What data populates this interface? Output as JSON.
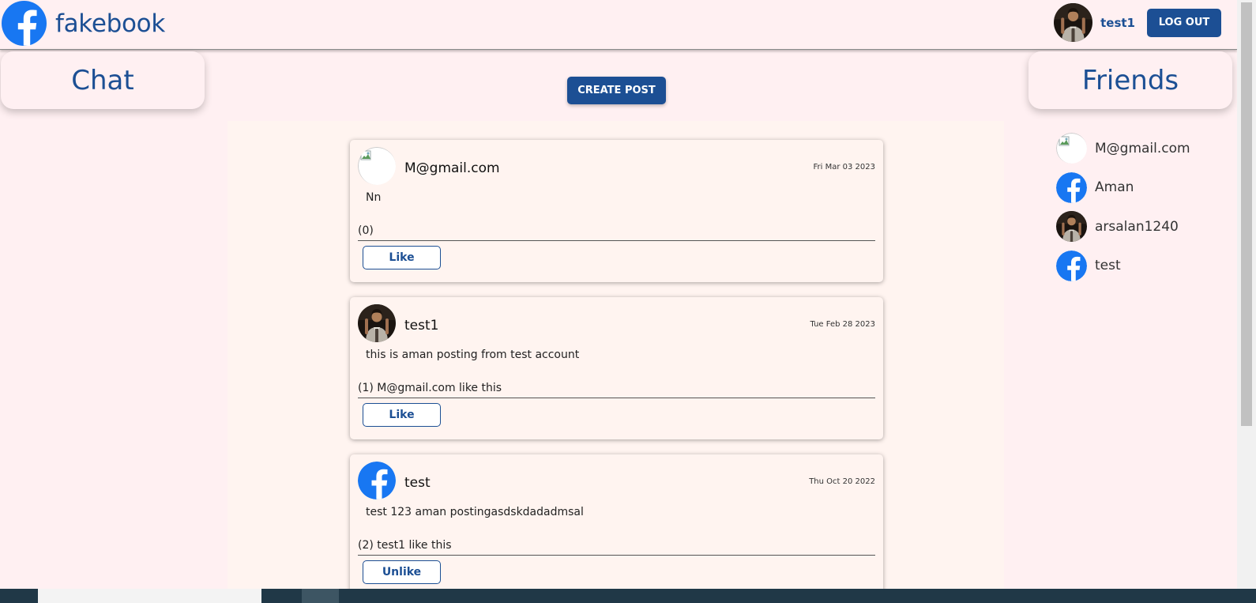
{
  "header": {
    "brand": "fakebook",
    "username": "test1",
    "logout_label": "LOG OUT"
  },
  "left_panel": {
    "title": "Chat"
  },
  "right_panel": {
    "title": "Friends"
  },
  "create_post_label": "CREATE POST",
  "posts": [
    {
      "author": "M@gmail.com",
      "date": "Fri Mar 03 2023",
      "body": "Nn",
      "likes": "(0)",
      "like_label": "Like",
      "avatar": "broken-image"
    },
    {
      "author": "test1",
      "date": "Tue Feb 28 2023",
      "body": "this is aman posting from test account",
      "likes": "(1) M@gmail.com like this",
      "like_label": "Like",
      "avatar": "photo"
    },
    {
      "author": "test",
      "date": "Thu Oct 20 2022",
      "body": "test 123 aman postingasdskdadadmsal",
      "likes": "(2) test1 like this",
      "like_label": "Unlike",
      "avatar": "facebook-logo"
    }
  ],
  "friends": [
    {
      "name": "M@gmail.com",
      "avatar": "broken-image"
    },
    {
      "name": "Aman",
      "avatar": "facebook-logo"
    },
    {
      "name": "arsalan1240",
      "avatar": "photo"
    },
    {
      "name": "test",
      "avatar": "facebook-logo"
    }
  ],
  "colors": {
    "brand": "#1c4f94",
    "background": "#fff0f2",
    "card": "#fff4f0",
    "logo_blue": "#1877f2"
  }
}
